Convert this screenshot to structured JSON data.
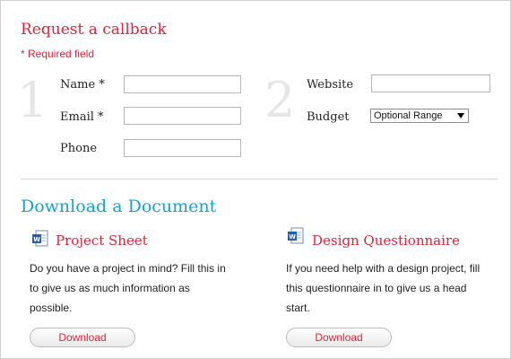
{
  "callback": {
    "title": "Request a callback",
    "required_note": "* Required field",
    "step1_number": "1",
    "step2_number": "2",
    "fields": {
      "name_label": "Name *",
      "email_label": "Email *",
      "phone_label": "Phone",
      "website_label": "Website",
      "budget_label": "Budget",
      "budget_selected": "Optional Range"
    }
  },
  "download": {
    "title": "Download a Document",
    "items": [
      {
        "title": "Project Sheet",
        "description": "Do you have a project in mind? Fill this in to give us as much information as possible.",
        "button": "Download",
        "icon": "word-document-icon"
      },
      {
        "title": "Design Questionnaire",
        "description": "If you need help with a design project, fill this questionnaire in to give us a head start.",
        "button": "Download",
        "icon": "word-document-icon"
      }
    ]
  },
  "colors": {
    "accent_red": "#e0233a",
    "accent_blue": "#13a3cf"
  }
}
